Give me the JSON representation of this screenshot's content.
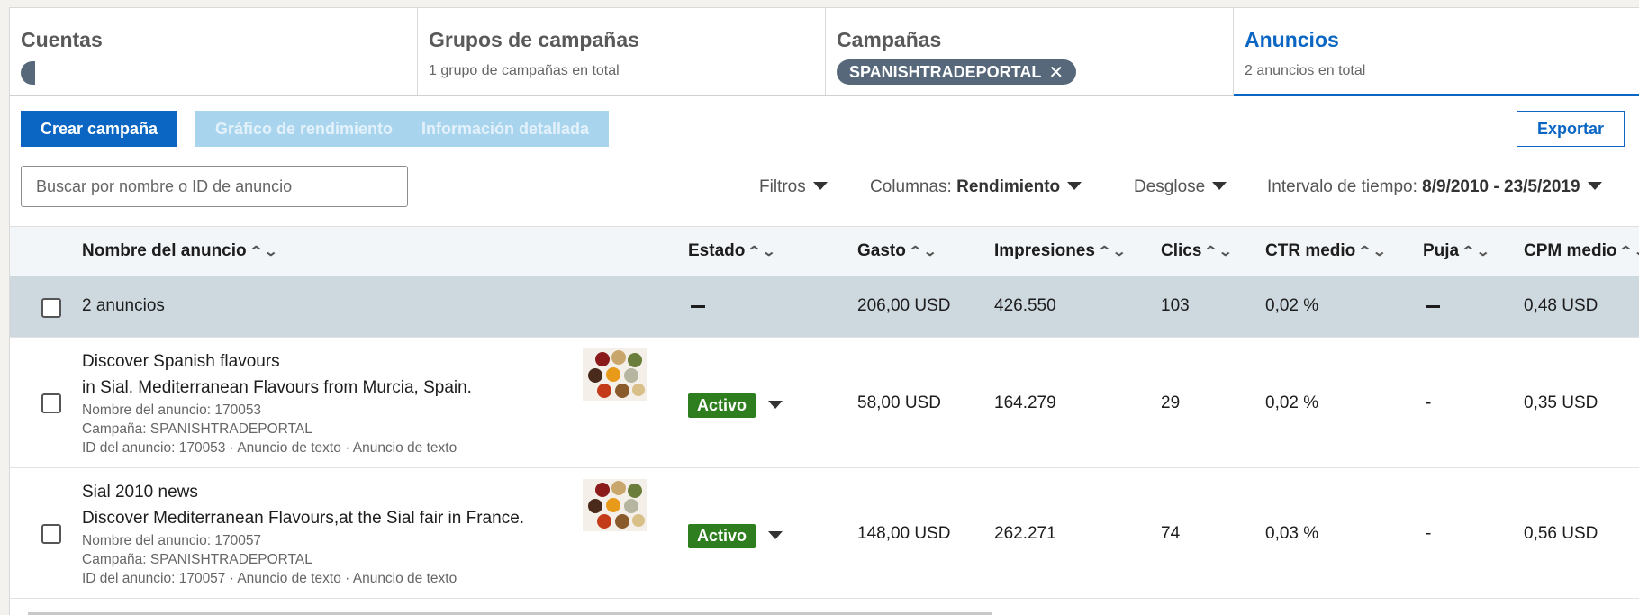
{
  "tabs": [
    {
      "title": "Cuentas",
      "sub": ""
    },
    {
      "title": "Grupos de campañas",
      "sub": "1 grupo de campañas en total"
    },
    {
      "title": "Campañas",
      "chip": "SPANISHTRADEPORTAL"
    },
    {
      "title": "Anuncios",
      "sub": "2 anuncios en total"
    }
  ],
  "toolbar": {
    "create": "Crear campaña",
    "chart": "Gráfico de rendimiento",
    "detail": "Información detallada",
    "export": "Exportar"
  },
  "filters": {
    "search_placeholder": "Buscar por nombre o ID de anuncio",
    "filtros": "Filtros",
    "columnas_label": "Columnas: ",
    "columnas_value": "Rendimiento",
    "desglose": "Desglose",
    "intervalo_label": "Intervalo de tiempo: ",
    "intervalo_value": "8/9/2010 - 23/5/2019"
  },
  "columns": {
    "name": "Nombre del anuncio",
    "estado": "Estado",
    "gasto": "Gasto",
    "impresiones": "Impresiones",
    "clics": "Clics",
    "ctr": "CTR medio",
    "puja": "Puja",
    "cpm": "CPM medio"
  },
  "summary": {
    "label": "2 anuncios",
    "gasto": "206,00 USD",
    "impresiones": "426.550",
    "clics": "103",
    "ctr": "0,02 %",
    "cpm": "0,48 USD"
  },
  "rows": [
    {
      "title1": "Discover Spanish flavours",
      "title2": "in Sial. Mediterranean Flavours from Murcia, Spain.",
      "meta1": "Nombre del anuncio: 170053",
      "meta2": "Campaña: SPANISHTRADEPORTAL",
      "meta3": "ID del anuncio: 170053 · Anuncio de texto · Anuncio de texto",
      "estado": "Activo",
      "gasto": "58,00 USD",
      "impresiones": "164.279",
      "clics": "29",
      "ctr": "0,02 %",
      "puja": "-",
      "cpm": "0,35 USD"
    },
    {
      "title1": "Sial 2010 news",
      "title2": "Discover Mediterranean Flavours,at the Sial fair in France.",
      "meta1": "Nombre del anuncio: 170057",
      "meta2": "Campaña: SPANISHTRADEPORTAL",
      "meta3": "ID del anuncio: 170057 · Anuncio de texto · Anuncio de texto",
      "estado": "Activo",
      "gasto": "148,00 USD",
      "impresiones": "262.271",
      "clics": "74",
      "ctr": "0,03 %",
      "puja": "-",
      "cpm": "0,56 USD"
    }
  ],
  "colors": {
    "accent": "#0a66c2",
    "active_badge": "#2e7d1f",
    "summary_bg": "#ced8df"
  }
}
